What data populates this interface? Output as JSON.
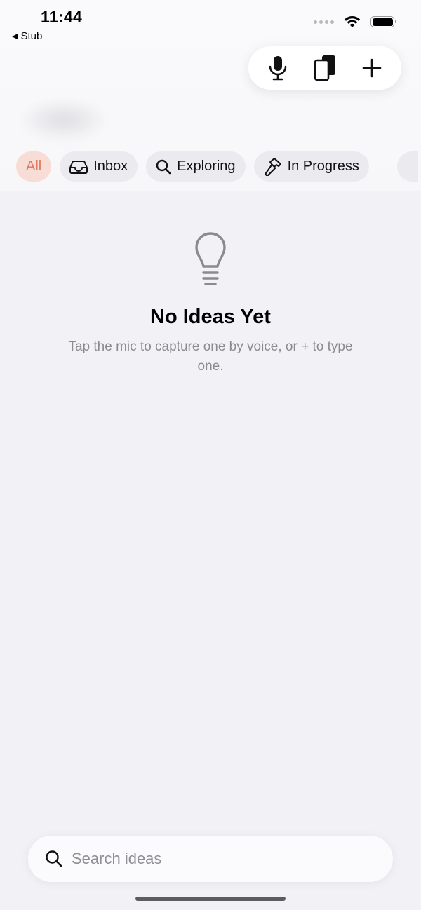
{
  "status_bar": {
    "time": "11:44",
    "back_app": "Stub",
    "back_arrow": "◀"
  },
  "toolbar": {
    "mic_icon": "microphone-icon",
    "stack_icon": "stacked-cards-icon",
    "add_icon": "plus-icon"
  },
  "filters": [
    {
      "label": "All",
      "icon": "",
      "active": true
    },
    {
      "label": "Inbox",
      "icon": "tray-icon",
      "active": false
    },
    {
      "label": "Exploring",
      "icon": "magnifier-icon",
      "active": false
    },
    {
      "label": "In Progress",
      "icon": "hammer-icon",
      "active": false
    }
  ],
  "empty_state": {
    "icon": "lightbulb-icon",
    "title": "No Ideas Yet",
    "subtitle": "Tap the mic to capture one by voice, or + to type one."
  },
  "search": {
    "placeholder": "Search ideas",
    "value": ""
  },
  "colors": {
    "accent": "#e07a62",
    "accent_bg": "#f8dcd6",
    "background": "#f2f1f6"
  }
}
